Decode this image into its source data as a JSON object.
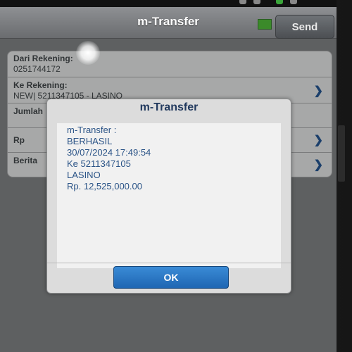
{
  "header": {
    "title": "m-Transfer",
    "send_label": "Send",
    "indicator_color": "#3b8a2a"
  },
  "form": {
    "from_label": "Dari Rekening:",
    "from_value": "0251744172",
    "to_label": "Ke Rekening:",
    "to_value": "NEW| 5211347105 - LASINO",
    "amount_label": "Jumlah",
    "currency_label": "Rp",
    "news_label": "Berita"
  },
  "dialog": {
    "title": "m-Transfer",
    "lines": [
      "m-Transfer :",
      "BERHASIL",
      "30/07/2024 17:49:54",
      "Ke 5211347105",
      "LASINO",
      "Rp. 12,525,000.00"
    ],
    "ok_label": "OK"
  },
  "icons": {
    "chevron": "chevron-right-icon"
  }
}
